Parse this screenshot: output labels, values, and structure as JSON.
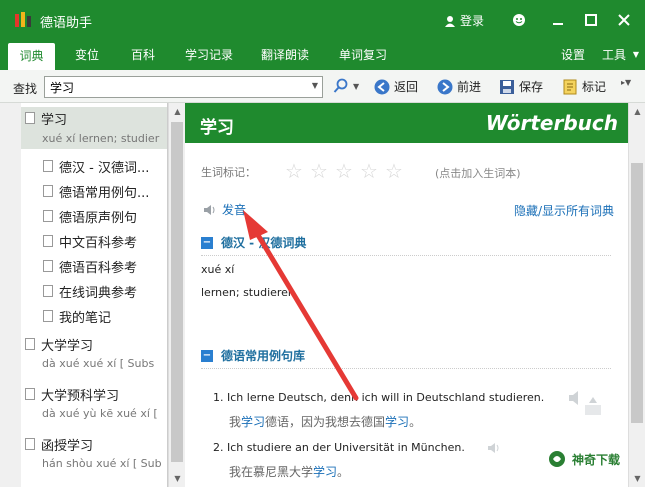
{
  "app": {
    "title": "德语助手",
    "login": "登录"
  },
  "tabs": [
    {
      "label": "词典",
      "active": true
    },
    {
      "label": "变位"
    },
    {
      "label": "百科"
    },
    {
      "label": "学习记录"
    },
    {
      "label": "翻译朗读"
    },
    {
      "label": "单词复习"
    }
  ],
  "right_menu": {
    "settings": "设置",
    "tools": "工具"
  },
  "toolbar": {
    "find_label": "查找",
    "search_value": "学习",
    "back": "返回",
    "forward": "前进",
    "save": "保存",
    "mark": "标记"
  },
  "left_list": {
    "items": [
      {
        "label": "学习",
        "sub": "xué xí lernen; studier"
      },
      {
        "label": "德汉 - 汉德词..."
      },
      {
        "label": "德语常用例句..."
      },
      {
        "label": "德语原声例句"
      },
      {
        "label": "中文百科参考"
      },
      {
        "label": "德语百科参考"
      },
      {
        "label": "在线词典参考"
      },
      {
        "label": "我的笔记"
      },
      {
        "label": "大学学习",
        "sub": "dà xué xué xí [ Subs"
      },
      {
        "label": "大学预科学习",
        "sub": "dà xué yù kē xué xí ["
      },
      {
        "label": "函授学习",
        "sub": "hán shòu xué xí [ Sub"
      }
    ]
  },
  "entry": {
    "headword": "学习",
    "brand": "Wörterbuch",
    "stars_label": "生词标记：",
    "stars_hint": "(点击加入生词本)",
    "stars_level": 0,
    "pronounce": "发音",
    "toggle_all": "隐藏/显示所有词典",
    "dict_section": "德汉 - 汉德词典",
    "pinyin": "xué xí",
    "meaning": "lernen; studieren",
    "examples_section": "德语常用例句库",
    "examples": [
      {
        "num": "1.",
        "de": "Ich lerne Deutsch, denn ich will in Deutschland studieren.",
        "cn_pre": "我",
        "cn_hl": "学习",
        "cn_mid": "德语，因为我想去德国",
        "cn_hl2": "学习",
        "cn_end": "。"
      },
      {
        "num": "2.",
        "de": "Ich studiere an der Universität in München.",
        "cn_pre": "我在慕尼黑大学",
        "cn_hl": "学习",
        "cn_mid": "。",
        "cn_hl2": "",
        "cn_end": ""
      }
    ]
  },
  "watermark": {
    "text": "神奇下载"
  },
  "colors": {
    "brand_green": "#1f8a2e",
    "link_blue": "#1a6fb7",
    "arrow_red": "#e53935"
  }
}
